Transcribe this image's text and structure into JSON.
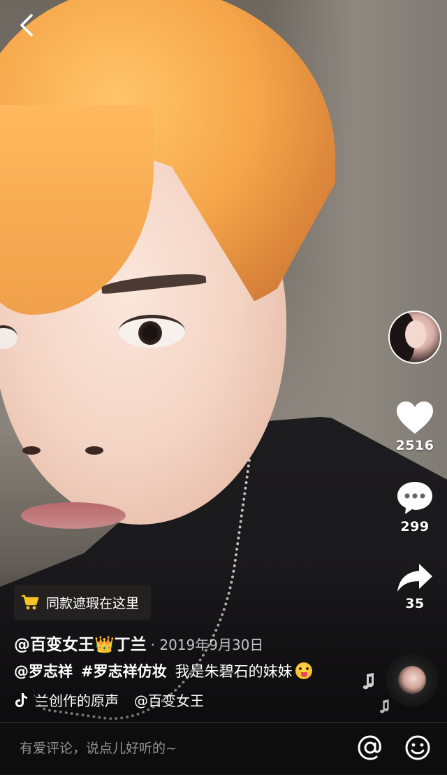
{
  "author": {
    "handle": "@百变女王👑丁兰",
    "date": "· 2019年9月30日"
  },
  "cart": {
    "label": "同款遮瑕在这里"
  },
  "description": {
    "mention": "@罗志祥",
    "hashtag": "#罗志祥仿妆",
    "text": "我是朱碧石的妹妹"
  },
  "music": {
    "title": "兰创作的原声",
    "owner": "@百变女王"
  },
  "stats": {
    "likes": "2516",
    "comments": "299",
    "shares": "35"
  },
  "comment_bar": {
    "placeholder": "有爱评论，说点儿好听的~"
  },
  "icons": {
    "back": "chevron-left-icon",
    "like": "heart-icon",
    "comment": "speech-bubble-icon",
    "share": "share-arrow-icon",
    "cart": "shopping-cart-icon",
    "tiktok": "tiktok-note-icon",
    "at": "at-sign-icon",
    "emoji": "smiley-icon"
  },
  "colors": {
    "cart_icon": "#f7c325",
    "text": "#ffffff"
  }
}
